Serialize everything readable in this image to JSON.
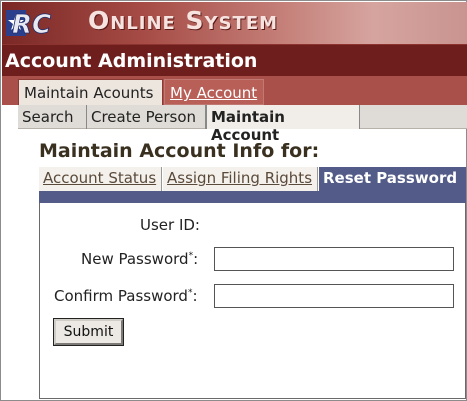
{
  "header": {
    "logo_text": "RRC",
    "title": "Online System"
  },
  "section": {
    "title": "Account Administration"
  },
  "main_tabs": [
    {
      "label": "Maintain Acounts",
      "active": true
    },
    {
      "label": "My Account ",
      "active": false
    }
  ],
  "sub_nav": [
    {
      "label": "Search"
    },
    {
      "label": "Create Person"
    },
    {
      "label": "Maintain Account",
      "active": true
    }
  ],
  "content": {
    "heading": "Maintain Account Info for:"
  },
  "inner_tabs": [
    {
      "label": "Account Status"
    },
    {
      "label": "Assign Filing Rights"
    },
    {
      "label": "Reset Password",
      "active": true
    }
  ],
  "form": {
    "user_id_label": "User ID:",
    "user_id_value": "",
    "new_password_label": "New Password",
    "confirm_password_label": "Confirm Password",
    "required_mark": "*",
    "colon": ":",
    "new_password_value": "",
    "confirm_password_value": "",
    "submit_label": "Submit"
  },
  "colors": {
    "banner_dark": "#7a2826",
    "section_bar": "#6e1f1d",
    "tab_row": "#a9504a",
    "active_inner_tab": "#535c88"
  }
}
